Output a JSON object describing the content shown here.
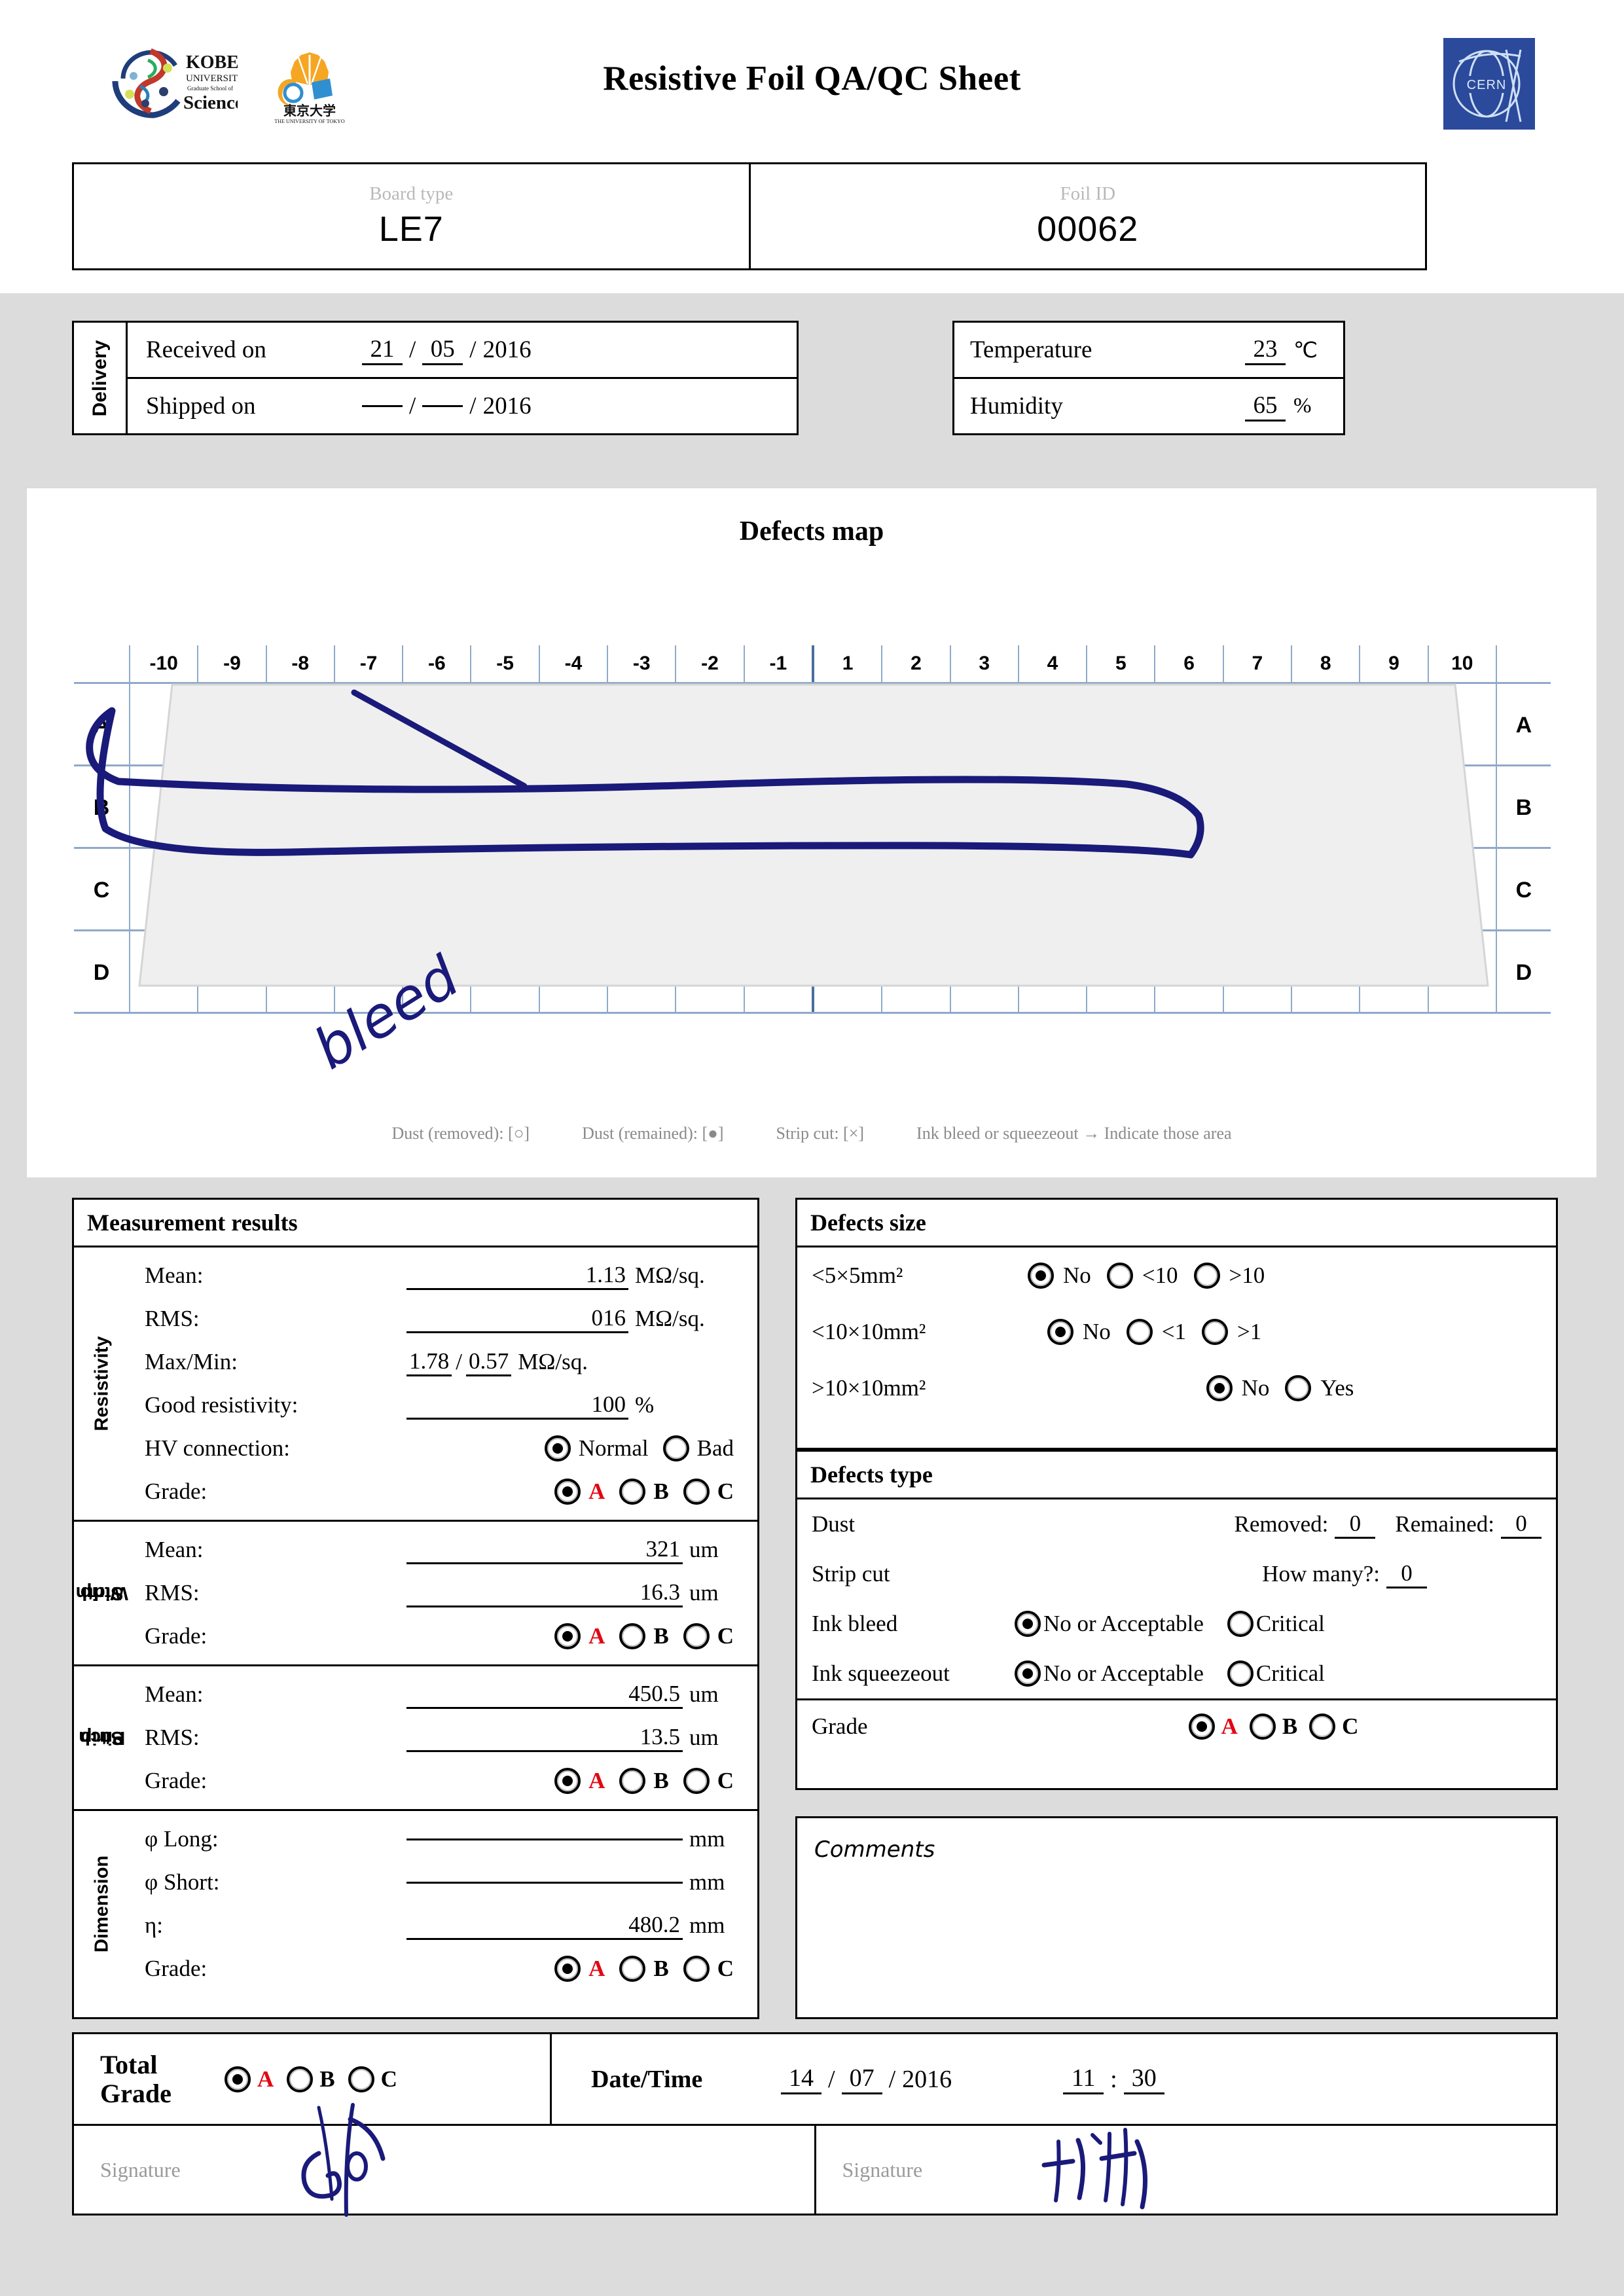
{
  "header": {
    "title": "Resistive Foil QA/QC Sheet",
    "logos": [
      "kobe-university-logo",
      "university-of-tokyo-logo",
      "cern-logo"
    ],
    "cern_text": "CERN"
  },
  "identification": {
    "board_type_label": "Board type",
    "board_type_value": "LE7",
    "foil_id_label": "Foil ID",
    "foil_id_value": "00062"
  },
  "delivery": {
    "side_label": "Delivery",
    "received_label": "Received on",
    "received_day": "21",
    "received_month": "05",
    "received_year": "2016",
    "shipped_label": "Shipped on",
    "shipped_day": "",
    "shipped_month": "",
    "shipped_year": "2016",
    "sep": "/"
  },
  "environment": {
    "temperature_label": "Temperature",
    "temperature_value": "23",
    "temperature_unit": "℃",
    "humidity_label": "Humidity",
    "humidity_value": "65",
    "humidity_unit": "%"
  },
  "defects_map": {
    "title": "Defects map",
    "columns": [
      "-10",
      "-9",
      "-8",
      "-7",
      "-6",
      "-5",
      "-4",
      "-3",
      "-2",
      "-1",
      "1",
      "2",
      "3",
      "4",
      "5",
      "6",
      "7",
      "8",
      "9",
      "10"
    ],
    "rows": [
      "A",
      "B",
      "C",
      "D"
    ],
    "annotation_text": "bleed",
    "legend": [
      "Dust (removed): [○]",
      "Dust (remained): [●]",
      "Strip cut: [×]",
      "Ink bleed or squeezeout → Indicate those area"
    ]
  },
  "measurement": {
    "title": "Measurement results",
    "resistivity": {
      "side_label": "Resistivity",
      "mean_label": "Mean:",
      "mean_value": "1.13",
      "mean_unit": "MΩ/sq.",
      "rms_label": "RMS:",
      "rms_value": "016",
      "rms_unit": "MΩ/sq.",
      "maxmin_label": "Max/Min:",
      "max_value": "1.78",
      "min_value": "0.57",
      "maxmin_unit": "MΩ/sq.",
      "good_label": "Good resistivity:",
      "good_value": "100",
      "good_unit": "%",
      "hv_label": "HV connection:",
      "hv_options": [
        "Normal",
        "Bad"
      ],
      "hv_selected": "Normal",
      "grade_label": "Grade:",
      "grade_options": [
        "A",
        "B",
        "C"
      ],
      "grade_selected": "A"
    },
    "strip_width": {
      "side_label": "Strip Width",
      "side_line1": "Strip",
      "side_line2": "Width",
      "mean_label": "Mean:",
      "mean_value": "321",
      "mean_unit": "um",
      "rms_label": "RMS:",
      "rms_value": "16.3",
      "rms_unit": "um",
      "grade_label": "Grade:",
      "grade_options": [
        "A",
        "B",
        "C"
      ],
      "grade_selected": "A"
    },
    "strip_pitch": {
      "side_label": "Strip Pitch",
      "side_line1": "Strip",
      "side_line2": "Pitch",
      "mean_label": "Mean:",
      "mean_value": "450.5",
      "mean_unit": "um",
      "rms_label": "RMS:",
      "rms_value": "13.5",
      "rms_unit": "um",
      "grade_label": "Grade:",
      "grade_options": [
        "A",
        "B",
        "C"
      ],
      "grade_selected": "A"
    },
    "dimension": {
      "side_label": "Dimension",
      "long_label": "φ Long:",
      "long_value": "",
      "long_unit": "mm",
      "short_label": "φ Short:",
      "short_value": "",
      "short_unit": "mm",
      "eta_label": "η:",
      "eta_value": "480.2",
      "eta_unit": "mm",
      "grade_label": "Grade:",
      "grade_options": [
        "A",
        "B",
        "C"
      ],
      "grade_selected": "A"
    }
  },
  "defects_size": {
    "title": "Defects size",
    "rows": [
      {
        "label": "<5×5mm²",
        "options": [
          "No",
          "<10",
          ">10"
        ],
        "selected": "No"
      },
      {
        "label": "<10×10mm²",
        "options": [
          "No",
          "<1",
          ">1"
        ],
        "selected": "No"
      },
      {
        "label": ">10×10mm²",
        "options": [
          "No",
          "Yes"
        ],
        "selected": "No"
      }
    ]
  },
  "defects_type": {
    "title": "Defects type",
    "dust_label": "Dust",
    "dust_removed_label": "Removed:",
    "dust_removed_value": "0",
    "dust_remained_label": "Remained:",
    "dust_remained_value": "0",
    "stripcut_label": "Strip cut",
    "stripcut_howmany_label": "How many?:",
    "stripcut_value": "0",
    "inkbleed_label": "Ink bleed",
    "inkbleed_options": [
      "No or Acceptable",
      "Critical"
    ],
    "inkbleed_selected": "No or Acceptable",
    "inksqueeze_label": "Ink squeezeout",
    "inksqueeze_options": [
      "No or Acceptable",
      "Critical"
    ],
    "inksqueeze_selected": "No or Acceptable",
    "grade_label": "Grade",
    "grade_options": [
      "A",
      "B",
      "C"
    ],
    "grade_selected": "A"
  },
  "comments": {
    "label": "Comments",
    "value": ""
  },
  "footer": {
    "total_grade_line1": "Total",
    "total_grade_line2": "Grade",
    "total_grade_options": [
      "A",
      "B",
      "C"
    ],
    "total_grade_selected": "A",
    "datetime_label": "Date/Time",
    "date_day": "14",
    "date_month": "07",
    "date_year": "2016",
    "time_hour": "11",
    "time_minute": "30",
    "date_sep": "/",
    "time_sep": ":",
    "signature_label_1": "Signature",
    "signature_label_2": "Signature"
  },
  "colors": {
    "grade_a_red": "#e30613",
    "ink_blue": "#1a1a7a",
    "grid_blue": "#8faac9",
    "page_grey": "#dcdcdc",
    "cern_blue": "#2b4a9b"
  }
}
